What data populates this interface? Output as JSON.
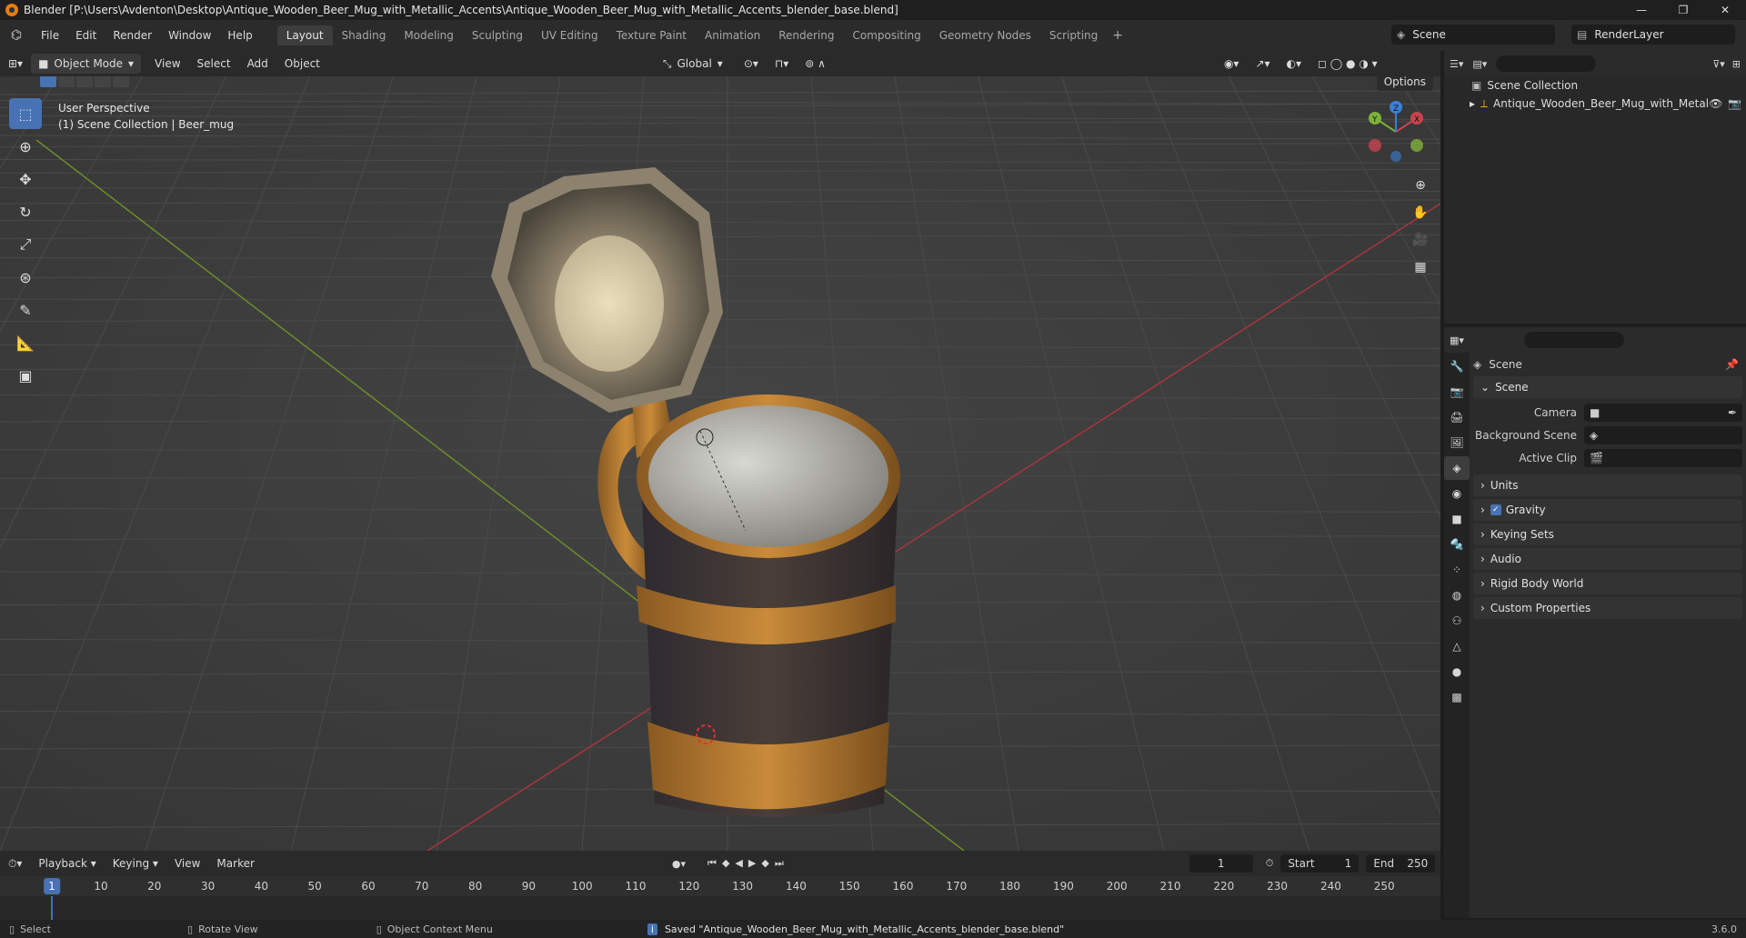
{
  "window": {
    "title": "Blender [P:\\Users\\Avdenton\\Desktop\\Antique_Wooden_Beer_Mug_with_Metallic_Accents\\Antique_Wooden_Beer_Mug_with_Metallic_Accents_blender_base.blend]",
    "minimize": "—",
    "maximize": "❐",
    "close": "✕"
  },
  "menu": [
    "File",
    "Edit",
    "Render",
    "Window",
    "Help"
  ],
  "workspaces": [
    "Layout",
    "Shading",
    "Modeling",
    "Sculpting",
    "UV Editing",
    "Texture Paint",
    "Animation",
    "Rendering",
    "Compositing",
    "Geometry Nodes",
    "Scripting"
  ],
  "active_workspace": "Layout",
  "scene": "Scene",
  "view_layer": "RenderLayer",
  "viewport": {
    "mode": "Object Mode",
    "menus": [
      "View",
      "Select",
      "Add",
      "Object"
    ],
    "transform_orientation": "Global",
    "perspective_label": "User Perspective",
    "collection_label": "(1) Scene Collection | Beer_mug",
    "options_label": "Options",
    "gizmo": {
      "x": "X",
      "y": "Y",
      "z": "Z"
    }
  },
  "outliner": {
    "root": "Scene Collection",
    "item": "Antique_Wooden_Beer_Mug_with_Metal"
  },
  "properties": {
    "header": "Scene",
    "panel_scene": "Scene",
    "camera_label": "Camera",
    "background_scene_label": "Background Scene",
    "active_clip_label": "Active Clip",
    "panels": [
      "Units",
      "Gravity",
      "Keying Sets",
      "Audio",
      "Rigid Body World",
      "Custom Properties"
    ]
  },
  "timeline": {
    "menus": [
      "Playback",
      "Keying",
      "View",
      "Marker"
    ],
    "current_frame": "1",
    "start_label": "Start",
    "start": "1",
    "end_label": "End",
    "end": "250",
    "ruler": [
      "10",
      "20",
      "30",
      "40",
      "50",
      "60",
      "70",
      "80",
      "90",
      "100",
      "110",
      "120",
      "130",
      "140",
      "150",
      "160",
      "170",
      "180",
      "190",
      "200",
      "210",
      "220",
      "230",
      "240",
      "250"
    ]
  },
  "status": {
    "select": "Select",
    "rotate": "Rotate View",
    "context": "Object Context Menu",
    "message": "Saved \"Antique_Wooden_Beer_Mug_with_Metallic_Accents_blender_base.blend\"",
    "version": "3.6.0"
  },
  "colors": {
    "accent": "#4772b3",
    "x_axis": "#c8444d",
    "y_axis": "#7fb23a",
    "z_axis": "#3b7fd6"
  }
}
